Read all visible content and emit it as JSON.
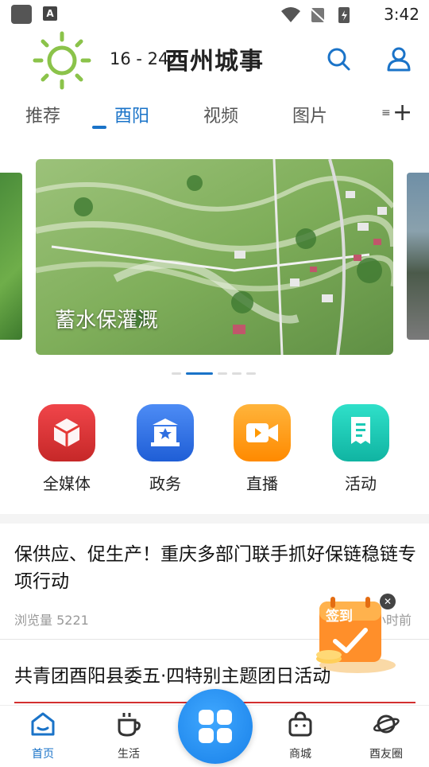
{
  "status_bar": {
    "time": "3:42",
    "a_icon": "A",
    "icons": [
      "notification-square-icon",
      "a-app-icon",
      "wifi-icon",
      "no-sim-icon",
      "battery-charging-icon"
    ]
  },
  "header": {
    "temperature": "16 - 24",
    "brand": "酉州城事",
    "weather_icon": "sun-icon",
    "actions": [
      "search-icon",
      "user-icon"
    ]
  },
  "tabs": {
    "items": [
      "推荐",
      "酉阳",
      "视频",
      "图片",
      "≡"
    ],
    "active": "酉阳"
  },
  "carousel": {
    "caption": "蓄水保灌溉",
    "dot_count": 5,
    "active_index": 1
  },
  "quick_links": [
    {
      "label": "全媒体",
      "icon": "cube-icon",
      "color": "#e53935"
    },
    {
      "label": "政务",
      "icon": "government-icon",
      "color": "#2f6fe0"
    },
    {
      "label": "直播",
      "icon": "video-camera-icon",
      "color": "#ff9800"
    },
    {
      "label": "活动",
      "icon": "document-icon",
      "color": "#1bc9b5"
    }
  ],
  "news": [
    {
      "title": "保供应、促生产！重庆多部门联手抓好保链稳链专项行动",
      "views": "浏览量 5221",
      "time": "小时前"
    },
    {
      "title": "共青团酉阳县委五·四特别主题团日活动"
    }
  ],
  "popup": {
    "label": "签到"
  },
  "bottom_nav": [
    {
      "label": "首页",
      "icon": "home-icon",
      "active": true
    },
    {
      "label": "生活",
      "icon": "coffee-icon",
      "active": false
    },
    {
      "label": "商城",
      "icon": "shopping-bag-icon",
      "active": false
    },
    {
      "label": "酉友圈",
      "icon": "planet-icon",
      "active": false
    }
  ],
  "colors": {
    "accent": "#1a73c8",
    "sun": "#8bc34a"
  }
}
